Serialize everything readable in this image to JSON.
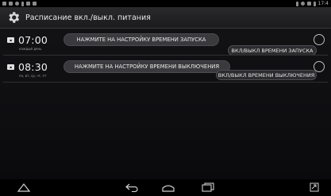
{
  "status_bar": {
    "time": "17:4"
  },
  "action_bar": {
    "title": "Расписание вкл./выкл. питания"
  },
  "schedules": [
    {
      "time": "07:00",
      "days": "каждый день",
      "set_time_button": "НАЖМИТЕ НА НАСТРОЙКУ ВРЕМЕНИ ЗАПУСКА",
      "switch_label": "ВКЛ/ВЫКЛ ВРЕМЕНИ ЗАПУСКА"
    },
    {
      "time": "08:30",
      "days": "пн, вт, ср, чт, пт",
      "set_time_button": "НАЖМИТЕ НА НАСТРОЙКУ ВРЕМЕНИ ВЫКЛЮЧЕНИЯ",
      "switch_label": "ВКЛ/ВЫКЛ ВРЕМЕНИ ВЫКЛЮЧЕНИЯ"
    }
  ],
  "colors": {
    "background": "#0b0b0d",
    "action_bar": "#222224",
    "pill": "#3a3a3e"
  },
  "icons": {
    "settings": "gear-icon",
    "alarm": "alarm-icon",
    "home_up": "up-caret-icon",
    "back": "back-icon",
    "home": "home-icon",
    "recent": "recent-apps-icon",
    "expand": "expand-icon"
  }
}
